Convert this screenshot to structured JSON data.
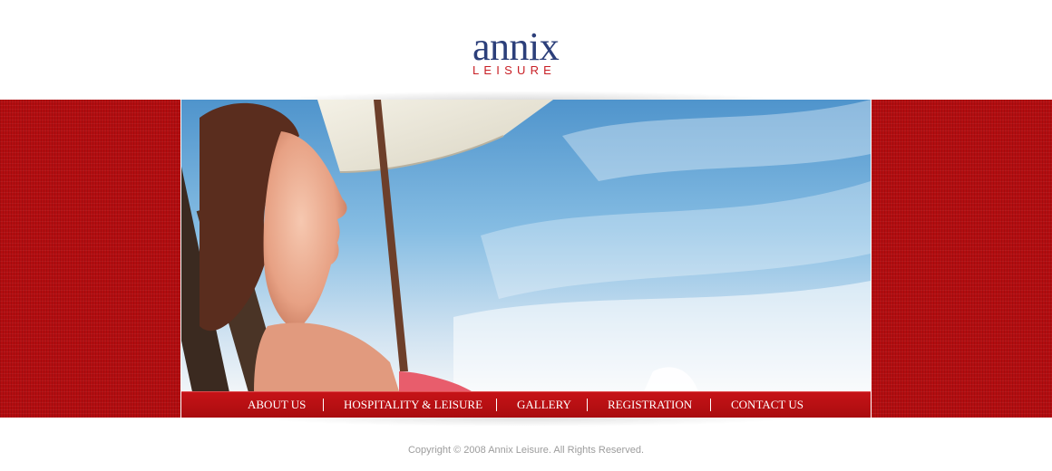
{
  "brand": {
    "name": "annix",
    "subtitle": "LEISURE",
    "primary_color": "#2c3f7a",
    "accent_color": "#c81e24"
  },
  "hero": {
    "image": "woman-sunbathing-under-umbrella"
  },
  "nav": {
    "items": [
      {
        "label": "ABOUT US"
      },
      {
        "label": "HOSPITALITY & LEISURE"
      },
      {
        "label": "GALLERY"
      },
      {
        "label": "REGISTRATION"
      },
      {
        "label": "CONTACT US"
      }
    ],
    "background_color": "#b80f12"
  },
  "footer": {
    "copyright": "Copyright © 2008 Annix Leisure. All Rights Reserved."
  }
}
